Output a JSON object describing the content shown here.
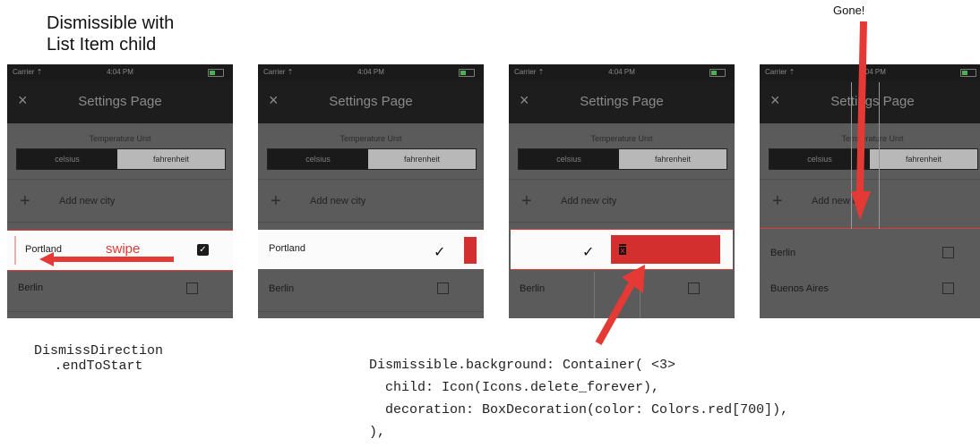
{
  "heading": {
    "line1": "Dismissible with",
    "line2": "List Item child"
  },
  "gone_label": "Gone!",
  "statusbar": {
    "carrier": "Carrier ⇡",
    "time": "4:04 PM"
  },
  "appbar": {
    "close": "×",
    "title": "Settings Page"
  },
  "temperature_unit": {
    "label": "Temperature Unit",
    "options": [
      "celsius",
      "fahrenheit"
    ],
    "selected": "celsius"
  },
  "add_city": {
    "icon": "plus-icon",
    "label": "Add new city"
  },
  "cities": [
    {
      "name": "Portland",
      "checked": true
    },
    {
      "name": "Berlin",
      "checked": false
    },
    {
      "name": "Buenos Aires",
      "checked": false
    }
  ],
  "swipe_label": "swipe",
  "direction_caption": {
    "line1": "DismissDirection",
    "line2": ".endToStart"
  },
  "code": {
    "line1": "Dismissible.background: Container( <3>",
    "line2": "  child: Icon(Icons.delete_forever),",
    "line3": "  decoration: BoxDecoration(color: Colors.red[700]),",
    "line4": "),"
  },
  "colors": {
    "accent_red": "#e03a3a",
    "background_red": "#d32f2f",
    "app_dark": "#1d1d1d",
    "body_grey": "#5b5b5b"
  },
  "icons": [
    "close-icon",
    "battery-icon",
    "plus-icon",
    "checkbox-icon",
    "delete-forever-icon",
    "arrow-icon"
  ]
}
